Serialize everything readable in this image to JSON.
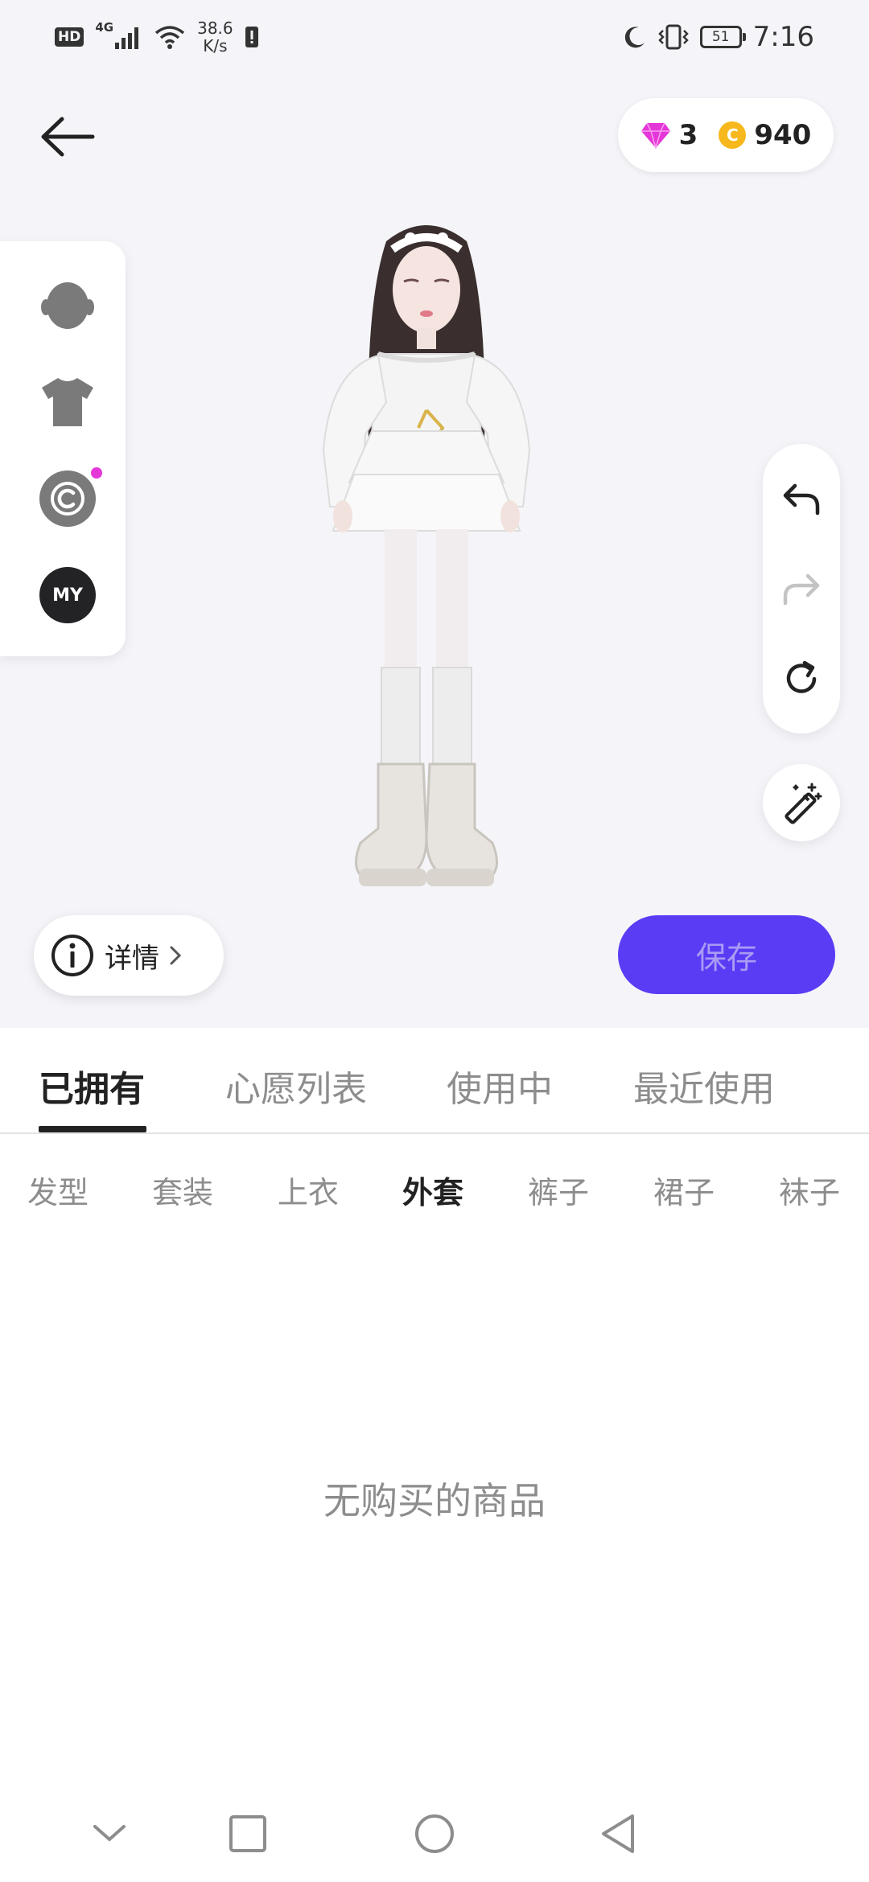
{
  "status_bar": {
    "hd": "HD",
    "network": "4G",
    "speed_value": "38.6",
    "speed_unit": "K/s",
    "battery": "51",
    "time": "7:16"
  },
  "currency": {
    "gems": "3",
    "coin_symbol": "C",
    "coins": "940"
  },
  "side_panel": {
    "my_label": "MY"
  },
  "detail_button": {
    "label": "详情"
  },
  "save_button": {
    "label": "保存"
  },
  "tabs": [
    {
      "label": "已拥有",
      "active": true
    },
    {
      "label": "心愿列表",
      "active": false
    },
    {
      "label": "使用中",
      "active": false
    },
    {
      "label": "最近使用",
      "active": false
    }
  ],
  "subcategories": [
    {
      "label": "发型"
    },
    {
      "label": "套装"
    },
    {
      "label": "上衣"
    },
    {
      "label": "外套",
      "active": true
    },
    {
      "label": "裤子"
    },
    {
      "label": "裙子"
    },
    {
      "label": "袜子"
    }
  ],
  "empty_message": "无购买的商品",
  "colors": {
    "accent": "#5b3cf5",
    "gem": "#e536d8",
    "coin": "#f6b81c"
  }
}
